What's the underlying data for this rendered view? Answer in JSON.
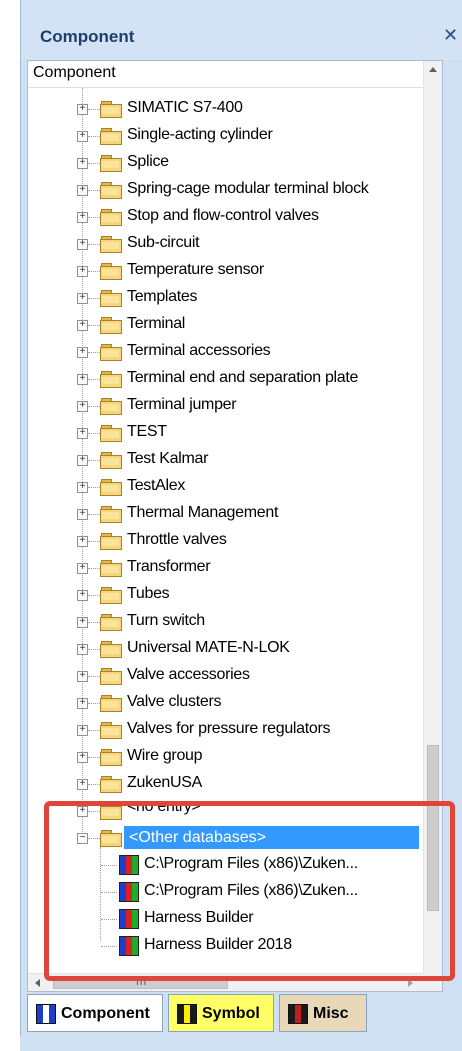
{
  "panel": {
    "title": "Component",
    "close_glyph": "✕"
  },
  "tree": {
    "column_header": "Component",
    "items": [
      {
        "label": "SIMATIC S7-400",
        "icon": "folder-icon"
      },
      {
        "label": "Single-acting cylinder",
        "icon": "folder-icon"
      },
      {
        "label": "Splice",
        "icon": "folder-icon"
      },
      {
        "label": "Spring-cage modular terminal block",
        "icon": "folder-icon"
      },
      {
        "label": "Stop and flow-control valves",
        "icon": "folder-icon"
      },
      {
        "label": "Sub-circuit",
        "icon": "folder-icon"
      },
      {
        "label": "Temperature sensor",
        "icon": "folder-icon"
      },
      {
        "label": "Templates",
        "icon": "folder-icon"
      },
      {
        "label": "Terminal",
        "icon": "folder-icon"
      },
      {
        "label": "Terminal accessories",
        "icon": "folder-icon"
      },
      {
        "label": "Terminal end and separation plate",
        "icon": "folder-icon"
      },
      {
        "label": "Terminal jumper",
        "icon": "folder-icon"
      },
      {
        "label": "TEST",
        "icon": "folder-icon"
      },
      {
        "label": "Test Kalmar",
        "icon": "folder-icon"
      },
      {
        "label": "TestAlex",
        "icon": "folder-icon"
      },
      {
        "label": "Thermal Management",
        "icon": "folder-icon"
      },
      {
        "label": "Throttle valves",
        "icon": "folder-icon"
      },
      {
        "label": "Transformer",
        "icon": "folder-icon"
      },
      {
        "label": "Tubes",
        "icon": "folder-icon"
      },
      {
        "label": "Turn switch",
        "icon": "folder-icon"
      },
      {
        "label": "Universal MATE-N-LOK",
        "icon": "folder-icon"
      },
      {
        "label": "Valve accessories",
        "icon": "folder-icon"
      },
      {
        "label": "Valve clusters",
        "icon": "folder-icon"
      },
      {
        "label": "Valves for pressure regulators",
        "icon": "folder-icon"
      },
      {
        "label": "Wire group",
        "icon": "folder-icon"
      },
      {
        "label": "ZukenUSA",
        "icon": "folder-icon"
      },
      {
        "label": "<no entry>",
        "icon": "folder-icon"
      }
    ],
    "other_databases": {
      "label": "<Other databases>",
      "expanded": true,
      "selected": true,
      "children": [
        {
          "label": "C:\\Program Files (x86)\\Zuken...",
          "icon": "database-icon"
        },
        {
          "label": "C:\\Program Files (x86)\\Zuken...",
          "icon": "database-icon"
        },
        {
          "label": "Harness Builder",
          "icon": "database-icon"
        },
        {
          "label": "Harness Builder 2018",
          "icon": "database-icon"
        }
      ]
    },
    "hscroll_grip": "III"
  },
  "tabs": [
    {
      "label": "Component",
      "active": true,
      "bg": "#ffffff",
      "icon": "component-tab-icon"
    },
    {
      "label": "Symbol",
      "active": false,
      "bg": "#ffff66",
      "icon": "symbol-tab-icon"
    },
    {
      "label": "Misc",
      "active": false,
      "bg": "#e8d8b8",
      "icon": "misc-tab-icon"
    }
  ],
  "colors": {
    "selection": "#3399ff",
    "highlight_frame": "#e0453b",
    "panel_bg": "#cfe0f3"
  }
}
